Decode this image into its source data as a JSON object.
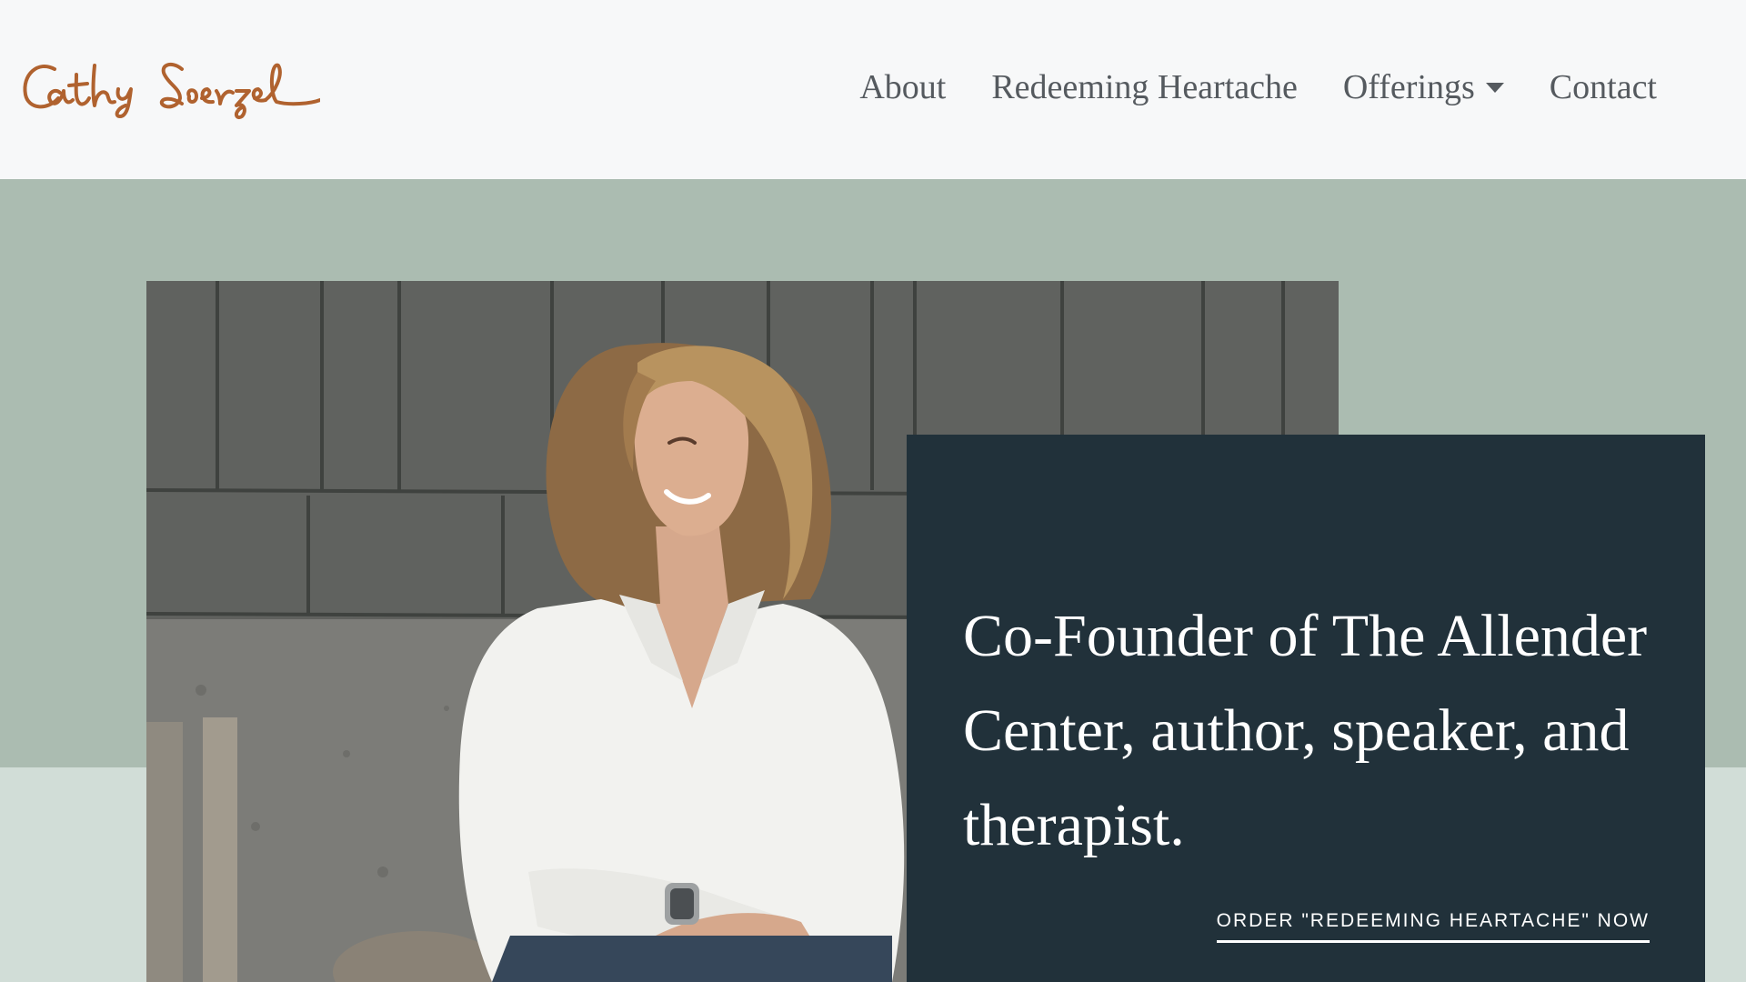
{
  "header": {
    "logo_text": "Cathy Loerzel",
    "logo_icon": "signature-logo",
    "nav": {
      "about": "About",
      "redeeming": "Redeeming Heartache",
      "offerings": "Offerings",
      "contact": "Contact"
    },
    "offerings_icon": "caret-down-icon"
  },
  "hero": {
    "photo_subject": "woman-portrait-photo",
    "headline": "Co-Founder of The Allender Center, author, speaker, and therapist.",
    "cta_label": "ORDER \"REDEEMING HEARTACHE\" NOW"
  },
  "colors": {
    "header_bg": "#f7f8f9",
    "nav_text": "#555a5f",
    "logo": "#b0622f",
    "band_top": "#abbcb1",
    "band_bottom": "#d1ddd7",
    "card_bg": "#21313a",
    "card_text": "#ffffff"
  }
}
